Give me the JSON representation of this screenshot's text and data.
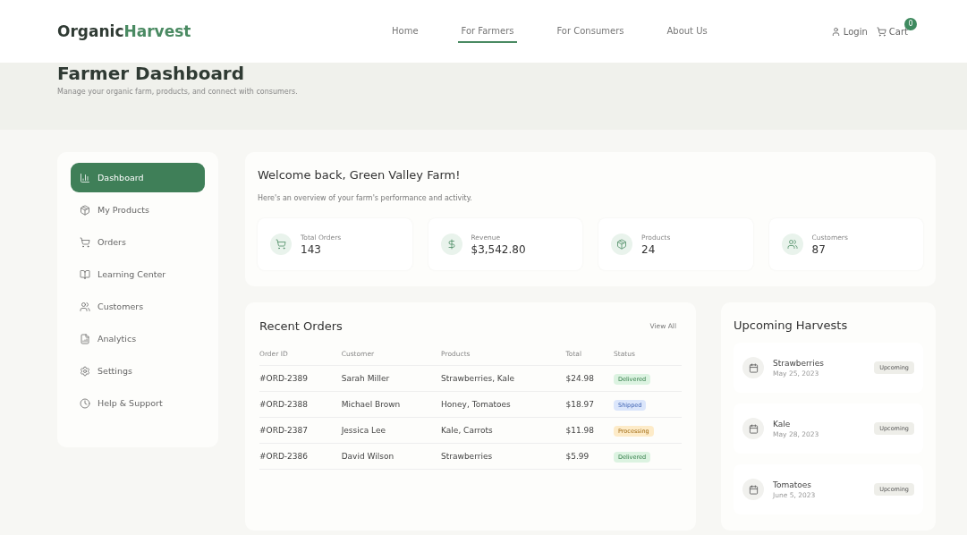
{
  "brand": {
    "first": "Organic",
    "second": "Harvest"
  },
  "nav": [
    {
      "label": "Home",
      "selected": false
    },
    {
      "label": "For Farmers",
      "selected": true
    },
    {
      "label": "For Consumers",
      "selected": false
    },
    {
      "label": "About Us",
      "selected": false
    }
  ],
  "login": "Login",
  "cart": {
    "label": "Cart",
    "count": "0"
  },
  "page": {
    "title": "Farmer Dashboard",
    "subtitle": "Manage your organic farm, products, and connect with consumers."
  },
  "sidebar": {
    "items": [
      {
        "label": "Dashboard",
        "selected": true
      },
      {
        "label": "My Products",
        "selected": false
      },
      {
        "label": "Orders",
        "selected": false
      },
      {
        "label": "Learning Center",
        "selected": false
      },
      {
        "label": "Customers",
        "selected": false
      },
      {
        "label": "Analytics",
        "selected": false
      },
      {
        "label": "Settings",
        "selected": false
      },
      {
        "label": "Help & Support",
        "selected": false
      }
    ]
  },
  "welcome": {
    "title": "Welcome back, Green Valley Farm!",
    "text": "Here's an overview of your farm's performance and activity.",
    "stats": [
      {
        "label": "Total Orders",
        "value": "143"
      },
      {
        "label": "Revenue",
        "value": "$3,542.80"
      },
      {
        "label": "Products",
        "value": "24"
      },
      {
        "label": "Customers",
        "value": "87"
      }
    ]
  },
  "orders": {
    "title": "Recent Orders",
    "view_all": "View All",
    "columns": [
      "Order ID",
      "Customer",
      "Products",
      "Total",
      "Status"
    ],
    "rows": [
      {
        "id": "#ORD-2389",
        "customer": "Sarah Miller",
        "products": "Strawberries, Kale",
        "total": "$24.98",
        "status": "Delivered",
        "kind": "delivered"
      },
      {
        "id": "#ORD-2388",
        "customer": "Michael Brown",
        "products": "Honey, Tomatoes",
        "total": "$18.97",
        "status": "Shipped",
        "kind": "shipped"
      },
      {
        "id": "#ORD-2387",
        "customer": "Jessica Lee",
        "products": "Kale, Carrots",
        "total": "$11.98",
        "status": "Processing",
        "kind": "processing"
      },
      {
        "id": "#ORD-2386",
        "customer": "David Wilson",
        "products": "Strawberries",
        "total": "$5.99",
        "status": "Delivered",
        "kind": "delivered"
      }
    ]
  },
  "harvests": {
    "title": "Upcoming Harvests",
    "items": [
      {
        "name": "Strawberries",
        "date": "May 25, 2023",
        "status": "Upcoming"
      },
      {
        "name": "Kale",
        "date": "May 28, 2023",
        "status": "Upcoming"
      },
      {
        "name": "Tomatoes",
        "date": "June 5, 2023",
        "status": "Upcoming"
      }
    ]
  }
}
